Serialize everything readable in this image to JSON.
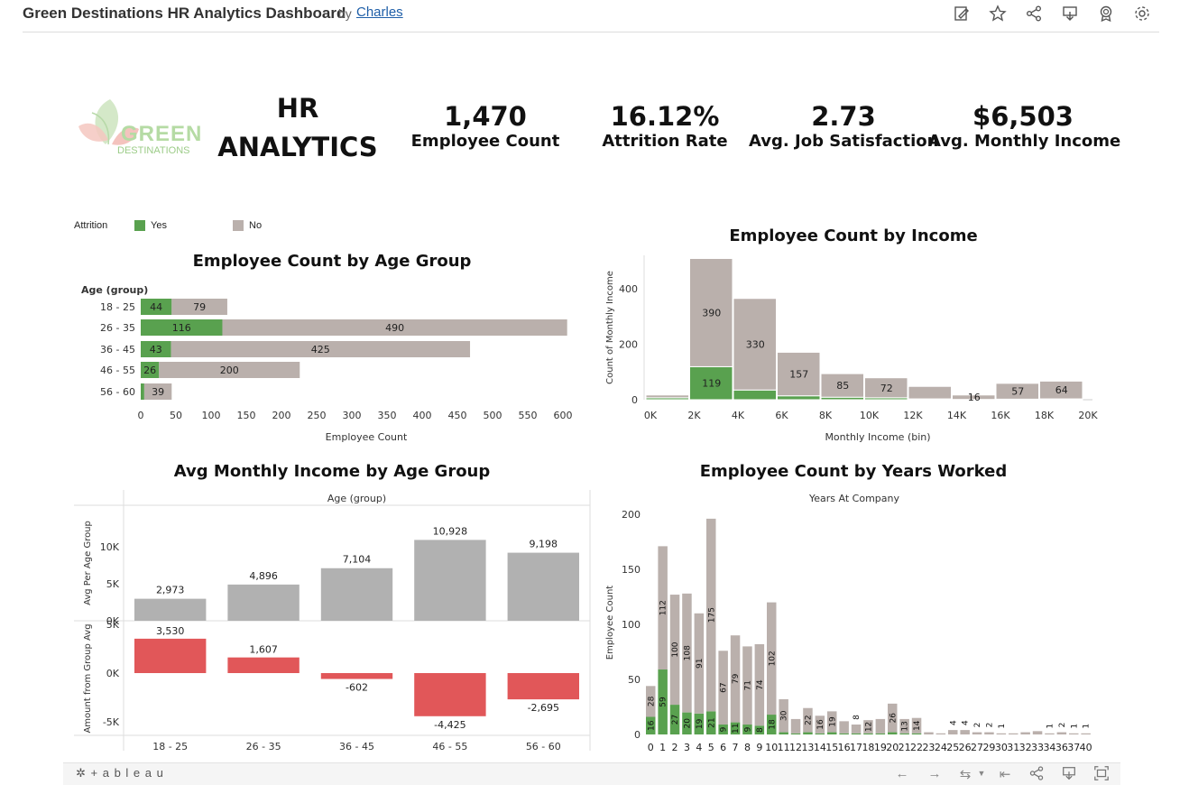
{
  "header": {
    "title": "Green Destinations HR Analytics Dashboard",
    "by": "by",
    "author": "Charles",
    "icons": [
      "edit-icon",
      "star-icon",
      "share-icon",
      "download-icon",
      "badge-icon",
      "settings-icon"
    ]
  },
  "logo": {
    "line1": "GREEN",
    "line2": "DESTINATIONS"
  },
  "dashboard": {
    "title_line1": "HR",
    "title_line2": "ANALYTICS"
  },
  "kpis": [
    {
      "value": "1,470",
      "label": "Employee Count"
    },
    {
      "value": "16.12%",
      "label": "Attrition Rate"
    },
    {
      "value": "2.73",
      "label": "Avg. Job Satisfaction"
    },
    {
      "value": "$6,503",
      "label": "Avg. Monthly Income"
    }
  ],
  "legend": {
    "title": "Attrition",
    "items": [
      {
        "label": "Yes",
        "color": "#59a14f"
      },
      {
        "label": "No",
        "color": "#bab0ac"
      }
    ]
  },
  "charts": {
    "age": {
      "title": "Employee Count by Age Group"
    },
    "income": {
      "title": "Employee Count by Income"
    },
    "avg": {
      "title": "Avg Monthly Income by Age Group"
    },
    "years": {
      "title": "Employee Count by Years Worked"
    }
  },
  "chart_data": [
    {
      "type": "bar",
      "orientation": "horizontal-stacked",
      "title": "Employee Count by Age Group",
      "ylabel": "Age (group)",
      "xlabel": "Employee Count",
      "categories": [
        "18 - 25",
        "26 - 35",
        "36 - 45",
        "46 - 55",
        "56 - 60"
      ],
      "series": [
        {
          "name": "Yes",
          "values": [
            44,
            116,
            43,
            26,
            5
          ]
        },
        {
          "name": "No",
          "values": [
            79,
            490,
            425,
            200,
            39
          ]
        }
      ],
      "xlim": [
        0,
        620
      ],
      "xticks": [
        0,
        50,
        100,
        150,
        200,
        250,
        300,
        350,
        400,
        450,
        500,
        550,
        600
      ],
      "grid": false,
      "legend": "top-left"
    },
    {
      "type": "bar",
      "orientation": "histogram-stacked",
      "title": "Employee Count by Income",
      "xlabel": "Monthly Income (bin)",
      "ylabel": "Count of Monthly Income",
      "bins": [
        0,
        2,
        4,
        6,
        8,
        10,
        12,
        14,
        16,
        18
      ],
      "bin_width": 2,
      "series": [
        {
          "name": "Yes",
          "values": [
            7,
            119,
            35,
            14,
            9,
            7,
            3,
            1,
            2,
            3
          ]
        },
        {
          "name": "No",
          "values": [
            10,
            390,
            330,
            157,
            85,
            72,
            45,
            16,
            57,
            64
          ]
        }
      ],
      "labels_no": [
        "",
        "390",
        "330",
        "157",
        "85",
        "72",
        "",
        "16",
        "57",
        "64"
      ],
      "labels_yes": [
        "",
        "119",
        "",
        "",
        "",
        "",
        "",
        "",
        "",
        ""
      ],
      "xticks": [
        "0K",
        "2K",
        "4K",
        "6K",
        "8K",
        "10K",
        "12K",
        "14K",
        "16K",
        "18K",
        "20K"
      ],
      "ylim": [
        0,
        515
      ],
      "yticks": [
        0,
        200,
        400
      ]
    },
    {
      "type": "bar",
      "title": "Avg Monthly Income by Age Group",
      "header": "Age (group)",
      "categories": [
        "18 - 25",
        "26 - 35",
        "36 - 45",
        "46 - 55",
        "56 - 60"
      ],
      "series": [
        {
          "name": "Avg Per Age Group",
          "values": [
            2973,
            4896,
            7104,
            10928,
            9198
          ],
          "labels": [
            "2,973",
            "4,896",
            "7,104",
            "10,928",
            "9,198"
          ]
        },
        {
          "name": "Amount from Group Avg",
          "values": [
            3530,
            1607,
            -602,
            -4425,
            -2695
          ],
          "labels": [
            "3,530",
            "1,607",
            "-602",
            "-4,425",
            "-2,695"
          ]
        }
      ],
      "top_yticks": [
        "0K",
        "5K",
        "10K"
      ],
      "bottom_yticks": [
        "5K",
        "0K",
        "-5K"
      ],
      "top_ylim": [
        0,
        12000
      ],
      "bottom_ylim": [
        -5500,
        5500
      ]
    },
    {
      "type": "bar",
      "orientation": "vertical-stacked",
      "title": "Employee Count by Years Worked",
      "xlabel": "Years At Company",
      "ylabel": "Employee Count",
      "categories": [
        "0",
        "1",
        "2",
        "3",
        "4",
        "5",
        "6",
        "7",
        "8",
        "9",
        "10",
        "11",
        "12",
        "13",
        "14",
        "15",
        "16",
        "17",
        "18",
        "19",
        "20",
        "21",
        "22",
        "23",
        "24",
        "25",
        "26",
        "27",
        "29",
        "30",
        "31",
        "32",
        "33",
        "34",
        "36",
        "37",
        "40"
      ],
      "series": [
        {
          "name": "Yes",
          "values": [
            16,
            59,
            27,
            20,
            19,
            21,
            9,
            11,
            9,
            8,
            18,
            2,
            1,
            2,
            1,
            2,
            1,
            1,
            1,
            1,
            2,
            1,
            1,
            0,
            0,
            0,
            0,
            0,
            0,
            0,
            0,
            0,
            0,
            0,
            0,
            0,
            0
          ]
        },
        {
          "name": "No",
          "values": [
            28,
            112,
            100,
            108,
            91,
            175,
            67,
            79,
            71,
            74,
            102,
            30,
            13,
            22,
            16,
            19,
            11,
            8,
            12,
            13,
            26,
            13,
            14,
            2,
            1,
            4,
            4,
            2,
            2,
            1,
            1,
            2,
            3,
            1,
            2,
            1,
            1
          ]
        }
      ],
      "labels_yes": [
        "16",
        "59",
        "27",
        "20",
        "19",
        "21",
        "9",
        "11",
        "9",
        "8",
        "18",
        "",
        "",
        "",
        "",
        "",
        "",
        "",
        "",
        "",
        "",
        "",
        "",
        "",
        "",
        "",
        "",
        "",
        "",
        "",
        "",
        "",
        "",
        "",
        "",
        "",
        ""
      ],
      "labels_no": [
        "28",
        "112",
        "100",
        "108",
        "91",
        "175",
        "67",
        "79",
        "71",
        "74",
        "102",
        "30",
        "",
        "22",
        "16",
        "19",
        "",
        "8",
        "12",
        "",
        "26",
        "13",
        "14",
        "",
        "",
        "4",
        "4",
        "2",
        "2",
        "1",
        "",
        "",
        "",
        "1",
        "2",
        "1",
        "1"
      ],
      "ylim": [
        0,
        215
      ],
      "yticks": [
        0,
        50,
        100,
        150,
        200
      ]
    }
  ],
  "footer": {
    "brand": "+ a b l e a u",
    "icons": [
      "undo-icon",
      "redo-icon",
      "revert-icon",
      "reset-icon",
      "share-icon",
      "download-icon",
      "fullscreen-icon"
    ]
  }
}
